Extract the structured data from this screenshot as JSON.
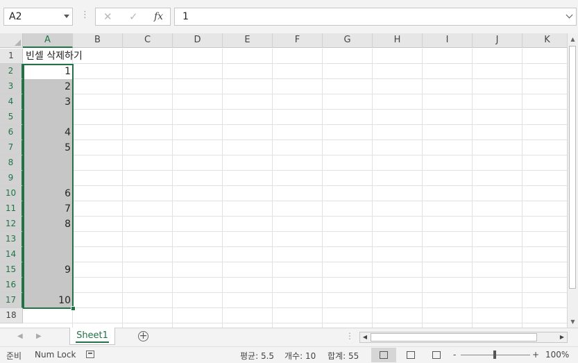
{
  "formula_bar": {
    "name_box": "A2",
    "cancel_icon": "✕",
    "enter_icon": "✓",
    "fx_label": "fx",
    "value": "1"
  },
  "columns": [
    "A",
    "B",
    "C",
    "D",
    "E",
    "F",
    "G",
    "H",
    "I",
    "J",
    "K"
  ],
  "rows": [
    "1",
    "2",
    "3",
    "4",
    "5",
    "6",
    "7",
    "8",
    "9",
    "10",
    "11",
    "12",
    "13",
    "14",
    "15",
    "16",
    "17",
    "18"
  ],
  "cells": {
    "A1": "빈셀 삭제하기",
    "A_values": [
      "1",
      "2",
      "3",
      "",
      "4",
      "5",
      "",
      "",
      "6",
      "7",
      "8",
      "",
      "",
      "9",
      "",
      "10"
    ]
  },
  "sheet_tabs": [
    "Sheet1"
  ],
  "status_bar": {
    "mode": "준비",
    "num_lock": "Num Lock",
    "average": "평균: 5.5",
    "count": "개수: 10",
    "sum": "합계: 55",
    "zoom_minus": "-",
    "zoom_plus": "+",
    "zoom": "100%"
  },
  "selection": {
    "active_cell": "A2",
    "range": "A2:A17"
  },
  "colors": {
    "accent": "#217346",
    "selection_fill": "#c6c6c6",
    "header_bg": "#e6e6e6",
    "gridline": "#e1e1e1"
  }
}
